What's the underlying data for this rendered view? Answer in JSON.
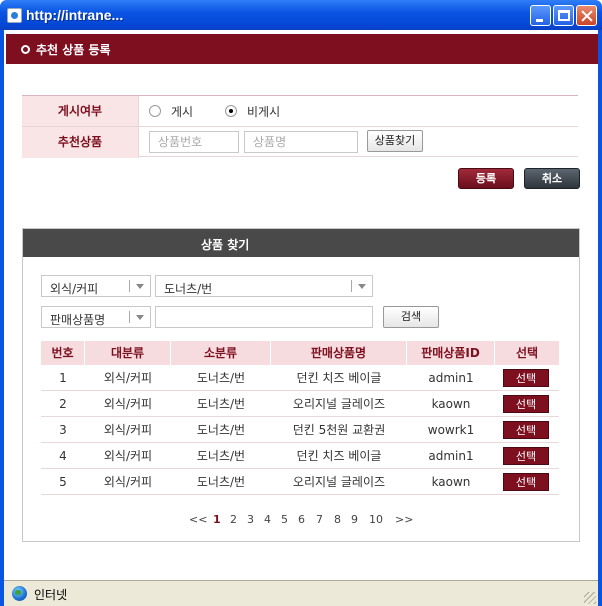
{
  "window": {
    "title": "http://intrane...",
    "status_text": "인터넷"
  },
  "page": {
    "title": "추천 상품 등록"
  },
  "form": {
    "display_label": "게시여부",
    "display_options": [
      "게시",
      "비게시"
    ],
    "display_selected": "비게시",
    "product_label": "추천상품",
    "product_no_placeholder": "상품번호",
    "product_name_placeholder": "상품명",
    "find_button": "상품찾기",
    "register_button": "등록",
    "cancel_button": "취소"
  },
  "search": {
    "title": "상품 찾기",
    "category1_value": "외식/커피",
    "category2_value": "도너츠/번",
    "field_value": "판매상품명",
    "keyword_value": "",
    "search_button": "검색"
  },
  "table": {
    "columns": [
      "번호",
      "대분류",
      "소분류",
      "판매상품명",
      "판매상품ID",
      "선택"
    ],
    "rows": [
      {
        "no": "1",
        "cat1": "외식/커피",
        "cat2": "도너츠/번",
        "name": "던킨 치즈 베이글",
        "id": "admin1",
        "action": "선택"
      },
      {
        "no": "2",
        "cat1": "외식/커피",
        "cat2": "도너츠/번",
        "name": "오리지널 글레이즈",
        "id": "kaown",
        "action": "선택"
      },
      {
        "no": "3",
        "cat1": "외식/커피",
        "cat2": "도너츠/번",
        "name": "던킨 5천원 교환권",
        "id": "wowrk1",
        "action": "선택"
      },
      {
        "no": "4",
        "cat1": "외식/커피",
        "cat2": "도너츠/번",
        "name": "던킨 치즈 베이글",
        "id": "admin1",
        "action": "선택"
      },
      {
        "no": "5",
        "cat1": "외식/커피",
        "cat2": "도너츠/번",
        "name": "오리지널 글레이즈",
        "id": "kaown",
        "action": "선택"
      }
    ]
  },
  "pager": {
    "prev": "<<",
    "pages": [
      "1",
      "2",
      "3",
      "4",
      "5",
      "6",
      "7",
      "8",
      "9",
      "10"
    ],
    "current": "1",
    "next": ">>"
  },
  "colors": {
    "accent": "#7d0f1f",
    "header_bg": "#494949",
    "label_bg": "#f9e4e6"
  }
}
